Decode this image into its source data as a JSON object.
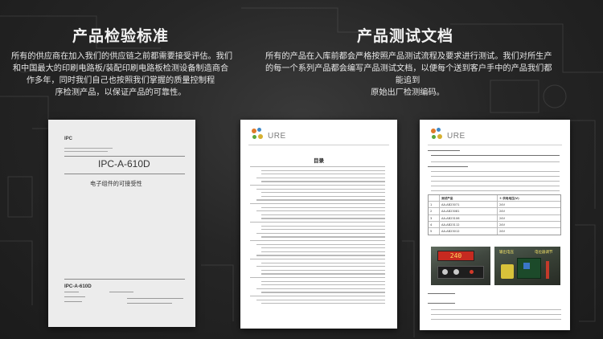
{
  "left_section": {
    "title": "产品检验标准",
    "paragraph_lines": [
      "所有的供应商在加入我们的供应链之前都需要接受评估。我们",
      "和中国最大的印刷电路板/装配印刷电路板检测设备制造商合",
      "作多年，同时我们自己也按照我们掌握的质量控制程",
      "序检测产品，以保证产品的可靠性。"
    ]
  },
  "right_section": {
    "title": "产品测试文档",
    "paragraph_lines": [
      "所有的产品在入库前都会严格按照产品测试流程及要求进行测试。我们对所生产",
      "的每一个系列产品都会编写产品测试文档，以便每个送到客户手中的产品我们都",
      "能追到",
      "原始出厂检测编码。"
    ]
  },
  "ipc_document": {
    "logo": "IPC",
    "title": "IPC-A-610D",
    "subtitle": "电子组件的可接受性",
    "footer_code": "IPC-A-610D"
  },
  "toc_document": {
    "logo": "URE",
    "heading": "目录"
  },
  "test_document": {
    "logo": "URE",
    "table_header": [
      "",
      "测试产品",
      "① 供电电压(V)"
    ],
    "table_rows": [
      [
        "1",
        "AA-AB23071",
        "24V"
      ],
      [
        "2",
        "AA-AB23081",
        "24V"
      ],
      [
        "3",
        "AA-AB23106",
        "24V"
      ],
      [
        "4",
        "AA-AB23112",
        "24V"
      ],
      [
        "5",
        "AA-AB23012",
        "24V"
      ]
    ],
    "meter_reading": "240",
    "photo_label_1": "输出电压",
    "photo_label_2": "电位器调节"
  },
  "colors": {
    "background": "#262626",
    "title": "#f2f2f2",
    "text": "#e6e6e6"
  }
}
